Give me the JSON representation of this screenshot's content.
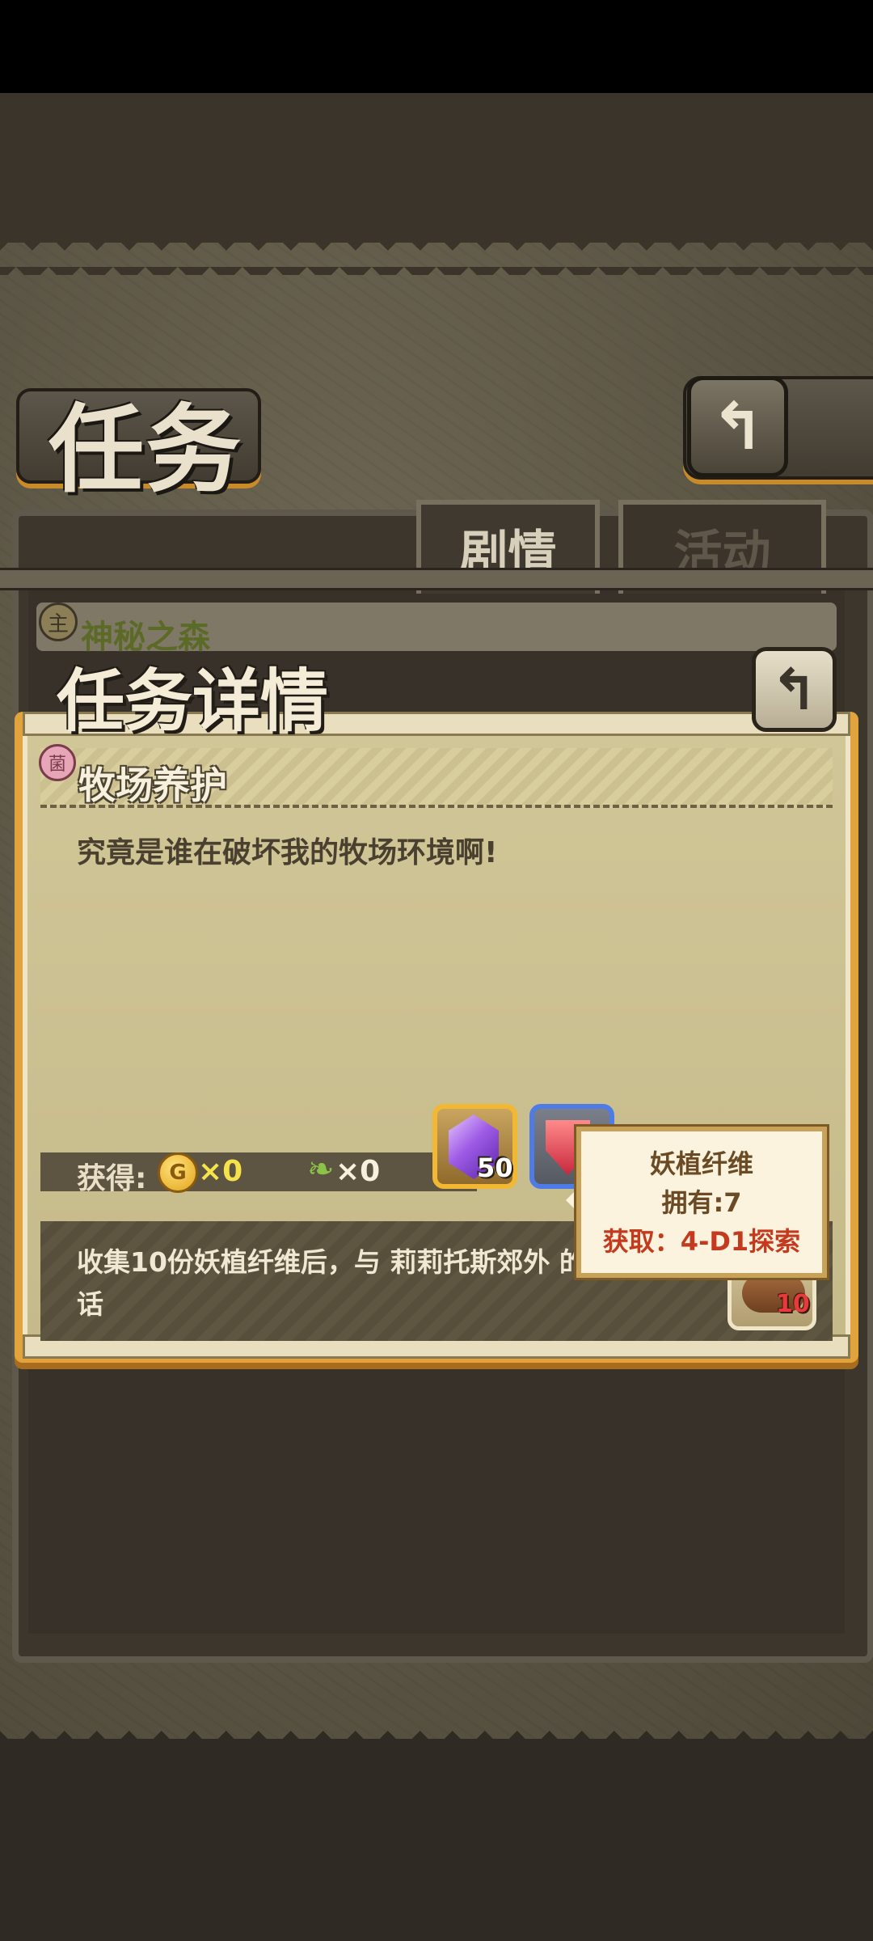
{
  "page": {
    "title": "任务",
    "tabs": [
      {
        "label": "剧情",
        "active": true
      },
      {
        "label": "活动",
        "active": false
      }
    ],
    "behind_quest_label": "神秘之森",
    "behind_badge": "主"
  },
  "detail": {
    "title": "任务详情",
    "quest_badge": "菌",
    "quest_name": "牧场养护",
    "description": "究竟是谁在破坏我的牧场环境啊!",
    "rewards": {
      "label": "获得:",
      "coin_symbol": "G",
      "coin_amount": "×0",
      "feather_amount": "×0",
      "crystal_count": "50"
    },
    "objective": "收集10份妖植纤维后，与 莉莉托斯郊外 的话",
    "required_item_count": "10"
  },
  "tooltip": {
    "name": "妖植纤维",
    "owned": "拥有:7",
    "source": "获取：4-D1探索"
  },
  "icons": {
    "back": "↰",
    "feather": "❧"
  },
  "colors": {
    "accent_orange": "#e2a33d",
    "tooltip_red": "#c43a1f",
    "coin_yellow": "#f6e24a"
  }
}
